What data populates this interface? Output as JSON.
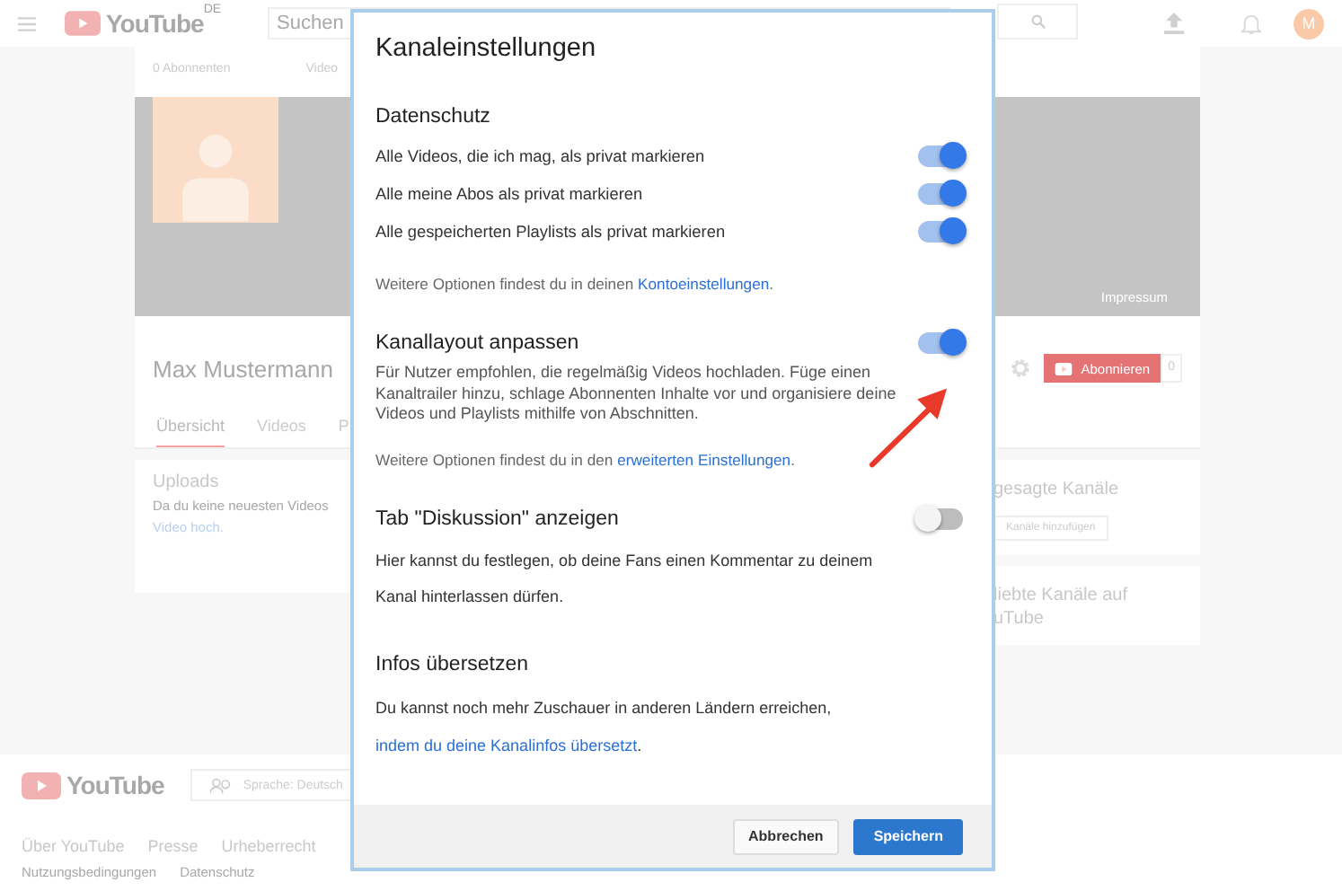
{
  "topbar": {
    "logo": "YouTube",
    "region": "DE",
    "search": {
      "placeholder": "Suchen"
    },
    "avatar": "M"
  },
  "channel": {
    "stats": [
      "0 Abonnenten",
      "Video"
    ],
    "banner_link": "Impressum",
    "name": "Max Mustermann",
    "subscribe": {
      "label": "Abonnieren",
      "count": "0"
    },
    "tabs": [
      {
        "label": "Übersicht",
        "selected": true
      },
      {
        "label": "Videos",
        "selected": false
      },
      {
        "label": "P",
        "selected": false
      }
    ],
    "uploads": {
      "title": "Uploads",
      "text": "Da du keine neuesten Videos",
      "link": "Video hoch."
    },
    "side_cards": [
      {
        "title_lines": [
          "gesagte Kanäle"
        ],
        "button": "Kanäle hinzufügen"
      },
      {
        "title_lines": [
          "liebte Kanäle auf",
          "uTube"
        ]
      }
    ]
  },
  "footer": {
    "logo": "YouTube",
    "language": "Sprache: Deutsch",
    "links": [
      "Über YouTube",
      "Presse",
      "Urheberrecht"
    ],
    "small_links": [
      "Nutzungsbedingungen",
      "Datenschutz"
    ]
  },
  "dialog": {
    "title": "Kanaleinstellungen",
    "sections": [
      {
        "kind": "toggles",
        "title": "Datenschutz",
        "toggles": [
          {
            "label": "Alle Videos, die ich mag, als privat markieren",
            "on": true
          },
          {
            "label": "Alle meine Abos als privat markieren",
            "on": true
          },
          {
            "label": "Alle gespeicherten Playlists als privat markieren",
            "on": true
          }
        ],
        "note": {
          "text": "Weitere Optionen findest du in deinen ",
          "link": "Kontoeinstellungen",
          "end": "."
        }
      },
      {
        "kind": "toggle",
        "title": "Kanallayout anpassen",
        "on": true,
        "description": "Für Nutzer empfohlen, die regelmäßig Videos hochladen. Füge einen Kanaltrailer hinzu, schlage Abonnenten Inhalte vor und organisiere deine Videos und Playlists mithilfe von Abschnitten.",
        "note": {
          "text": "Weitere Optionen findest du in den ",
          "link": "erweiterten Einstellungen",
          "end": "."
        }
      },
      {
        "kind": "toggle",
        "title": "Tab \"Diskussion\" anzeigen",
        "on": false,
        "description": "Hier kannst du festlegen, ob deine Fans einen Kommentar zu deinem Kanal hinterlassen dürfen."
      },
      {
        "kind": "info",
        "title": "Infos übersetzen",
        "note": {
          "text": "Du kannst noch mehr Zuschauer in anderen Ländern erreichen, ",
          "link": "indem du deine Kanalinfos übersetzt",
          "end": "."
        }
      }
    ],
    "buttons": [
      {
        "label": "Abbrechen",
        "kind": "secondary"
      },
      {
        "label": "Speichern",
        "kind": "primary"
      }
    ]
  }
}
